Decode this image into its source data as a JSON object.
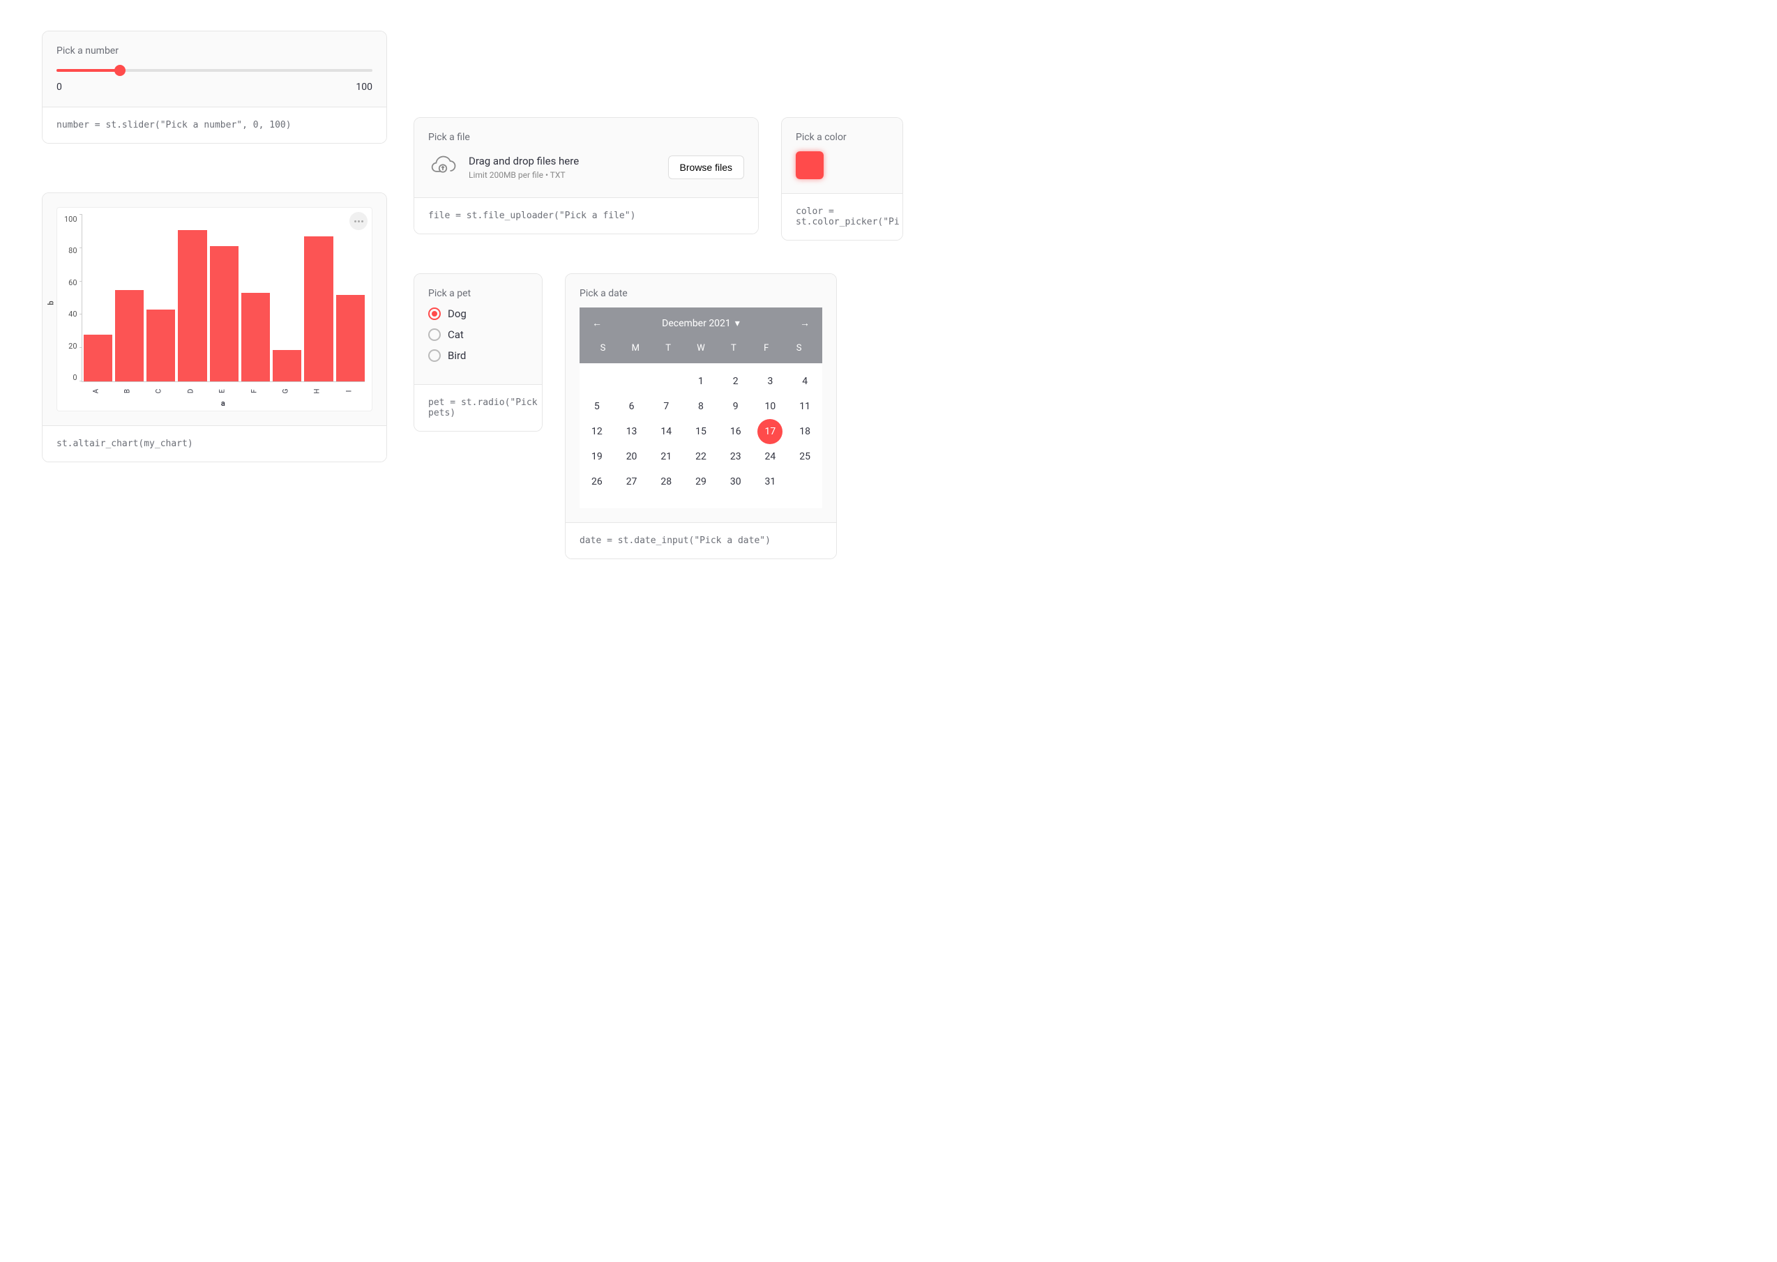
{
  "slider": {
    "label": "Pick a number",
    "min": "0",
    "max": "100",
    "percent": 20,
    "code": "number = st.slider(\"Pick a number\", 0, 100)"
  },
  "chart_data": {
    "type": "bar",
    "categories": [
      "A",
      "B",
      "C",
      "D",
      "E",
      "F",
      "G",
      "H",
      "I"
    ],
    "values": [
      28,
      55,
      43,
      91,
      81,
      53,
      19,
      87,
      52
    ],
    "xlabel": "a",
    "ylabel": "b",
    "ylim": [
      0,
      100
    ],
    "yticks": [
      0,
      20,
      40,
      60,
      80,
      100
    ]
  },
  "chart": {
    "code": "st.altair_chart(my_chart)"
  },
  "uploader": {
    "label": "Pick a file",
    "title": "Drag and drop files here",
    "sub": "Limit 200MB per file • TXT",
    "button": "Browse files",
    "code": "file = st.file_uploader(\"Pick a file\")"
  },
  "color": {
    "label": "Pick a color",
    "value": "#ff4b4b",
    "code": "color = st.color_picker(\"Pi"
  },
  "radio": {
    "label": "Pick a pet",
    "options": [
      "Dog",
      "Cat",
      "Bird"
    ],
    "selected": 0,
    "code": "pet = st.radio(\"Pick a pe\npets)"
  },
  "date": {
    "label": "Pick a date",
    "month_title": "December 2021",
    "dow": [
      "S",
      "M",
      "T",
      "W",
      "T",
      "F",
      "S"
    ],
    "first_dow": 3,
    "days_in_month": 31,
    "selected": 17,
    "code": "date = st.date_input(\"Pick a date\")"
  }
}
